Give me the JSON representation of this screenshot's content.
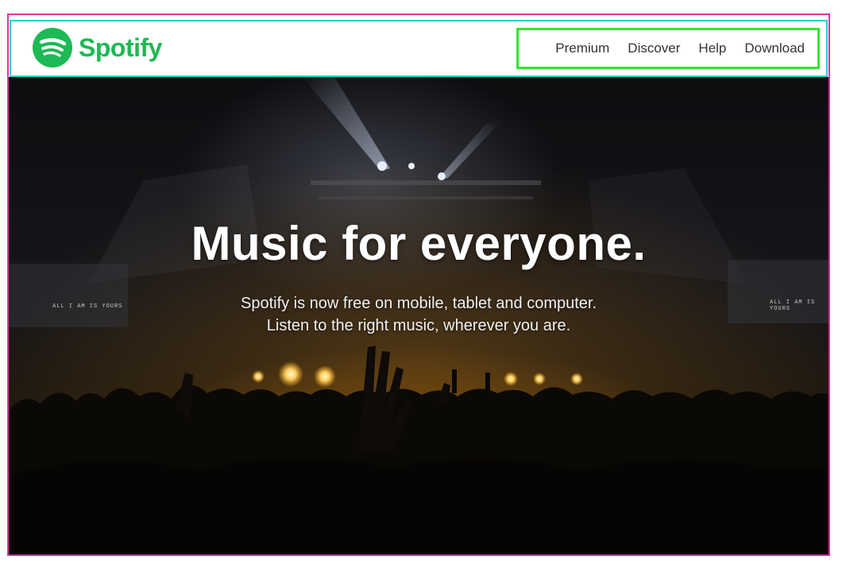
{
  "brand": {
    "name": "Spotify",
    "color": "#1db954"
  },
  "nav": {
    "items": [
      "Premium",
      "Discover",
      "Help",
      "Download"
    ]
  },
  "hero": {
    "title": "Music for everyone.",
    "subtitle_line1": "Spotify is now free on mobile, tablet and computer.",
    "subtitle_line2": "Listen to the right music, wherever you are.",
    "screen_caption_left": "ALL I AM IS YOURS",
    "screen_caption_right": "ALL I AM IS YOURS"
  },
  "annotation_colors": {
    "page_frame": "#e0339f",
    "header_frame": "#22d3d3",
    "nav_frame": "#33e633"
  }
}
